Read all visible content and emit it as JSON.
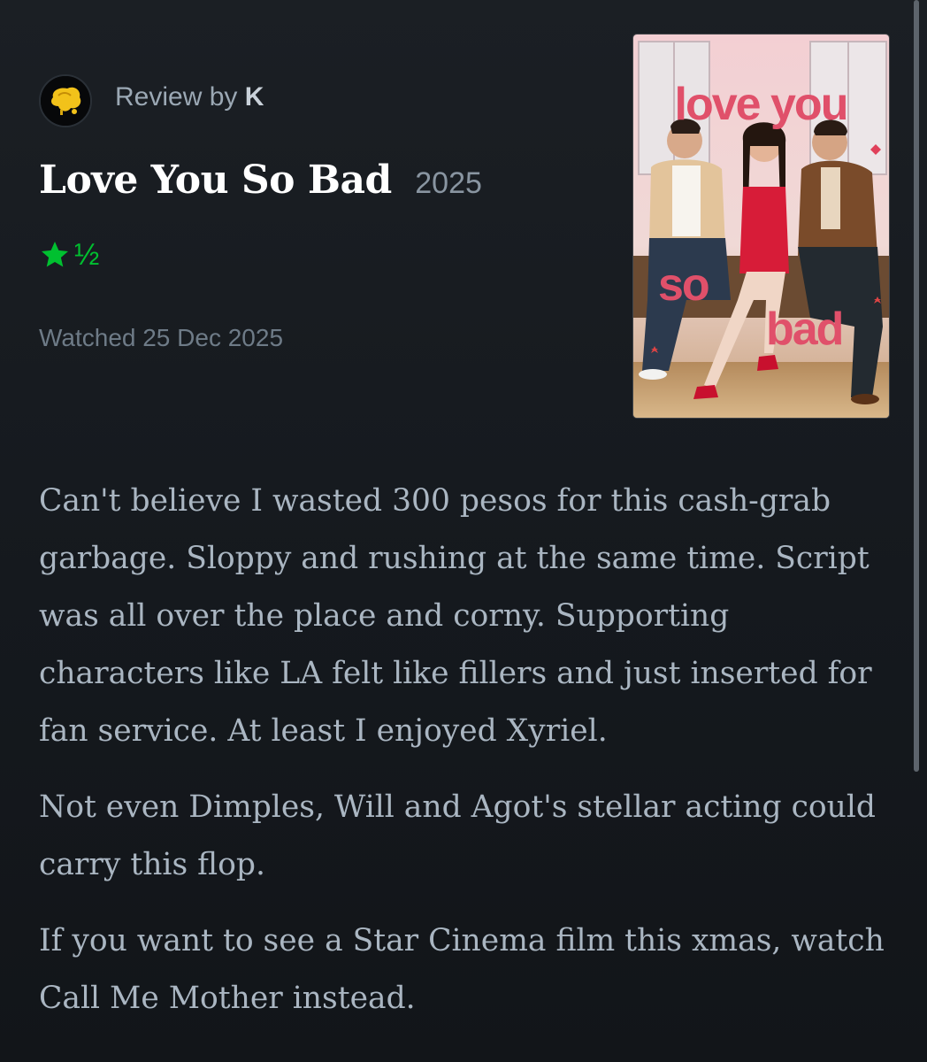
{
  "review": {
    "by_label": "Review by",
    "reviewer_name": "K",
    "film_title": "Love You So Bad",
    "film_year": "2025",
    "rating_half": "½",
    "rating_stars": 1.5,
    "watched_text": "Watched 25 Dec 2025",
    "paragraphs": [
      "Can't believe I wasted 300 pesos for this cash-grab garbage. Sloppy and rushing at the same time. Script was all over the place and corny. Supporting characters like LA felt like fillers and just inserted for fan service. At least I enjoyed Xyriel.",
      "Not even Dimples, Will and Agot's stellar acting could carry this flop.",
      "If you want to see a Star Cinema film this xmas, watch Call Me Mother instead."
    ]
  },
  "poster": {
    "title_line1": "love you",
    "title_line2": "so",
    "title_line3": "bad"
  },
  "colors": {
    "background": "#1b1f24",
    "rating_green": "#00c030",
    "review_text": "#aab6c2",
    "title_text": "#ffffff"
  },
  "icons": {
    "avatar": "avatar-yellow-blob",
    "rating": "star-icon",
    "scroll": "scrollbar"
  }
}
